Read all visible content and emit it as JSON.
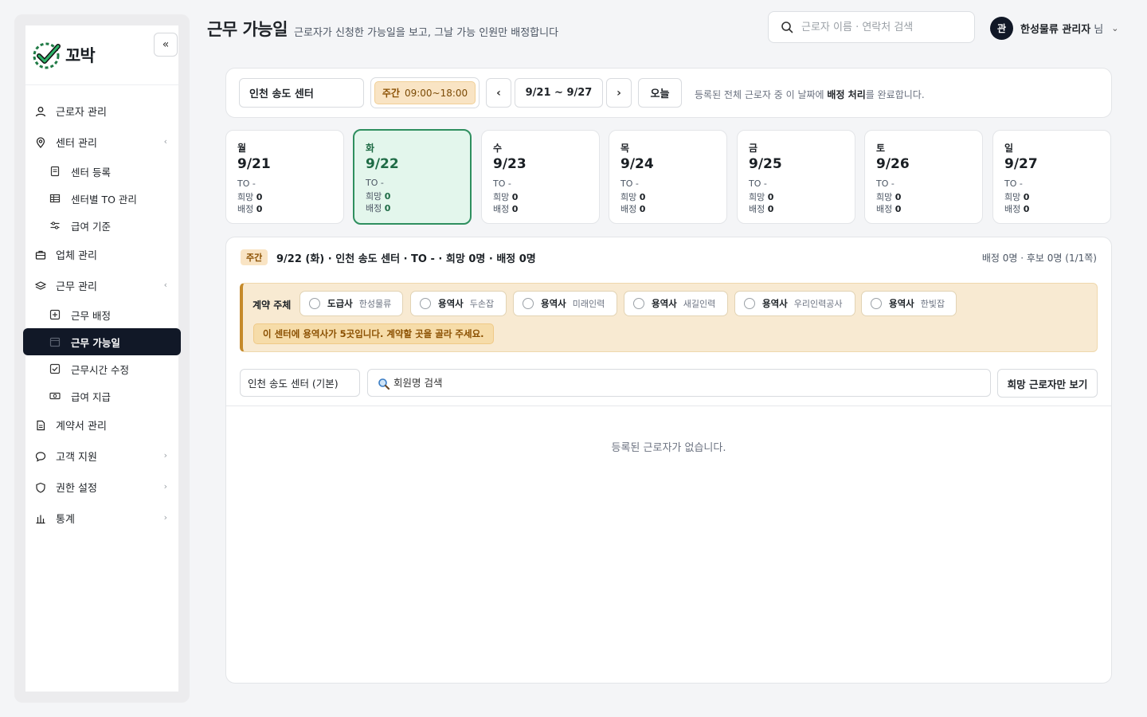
{
  "app": {
    "logo_text": "꼬박"
  },
  "sidebar": {
    "collapse_label": "«",
    "items": [
      {
        "label": "근로자 관리",
        "icon": "user-icon",
        "type": "item"
      },
      {
        "label": "센터 관리",
        "icon": "location-pin-icon",
        "type": "item",
        "chevron": "‹"
      },
      {
        "label": "센터 등록",
        "icon": "document-icon",
        "type": "sub"
      },
      {
        "label": "센터별 TO 관리",
        "icon": "table-icon",
        "type": "sub"
      },
      {
        "label": "급여 기준",
        "icon": "sliders-icon",
        "type": "sub"
      },
      {
        "label": "업체 관리",
        "icon": "briefcase-icon",
        "type": "item"
      },
      {
        "label": "근무 관리",
        "icon": "layers-icon",
        "type": "item",
        "chevron": "‹"
      },
      {
        "label": "근무 배정",
        "icon": "plus-square-icon",
        "type": "sub"
      },
      {
        "label": "근무 가능일",
        "icon": "calendar-icon",
        "type": "sub",
        "active": true
      },
      {
        "label": "근무시간 수정",
        "icon": "check-square-icon",
        "type": "sub"
      },
      {
        "label": "급여 지급",
        "icon": "banknote-icon",
        "type": "sub"
      },
      {
        "label": "계약서 관리",
        "icon": "contract-icon",
        "type": "item"
      },
      {
        "label": "고객 지원",
        "icon": "chat-icon",
        "type": "item",
        "chevron": "›"
      },
      {
        "label": "권한 설정",
        "icon": "shield-icon",
        "type": "item",
        "chevron": "›"
      },
      {
        "label": "통계",
        "icon": "bar-chart-icon",
        "type": "item",
        "chevron": "›"
      }
    ]
  },
  "header": {
    "title": "근무 가능일",
    "subtitle": "근로자가 신청한 가능일을 보고, 그날 가능 인원만 배정합니다",
    "search_placeholder": "근로자 이름 · 연락처 검색",
    "user_avatar": "관",
    "user_name": "한성물류 관리자",
    "user_suffix": "님",
    "user_chevron": "⌄"
  },
  "toolbar": {
    "center": "인천 송도 센터",
    "shift_label": "주간",
    "shift_time": "09:00~18:00",
    "prev": "‹",
    "range": "9/21 ~ 9/27",
    "next": "›",
    "today": "오늘",
    "note_prefix": "등록된 전체 근로자 중 이 날짜에 ",
    "note_bold": "배정 처리",
    "note_suffix": "를 완료합니다."
  },
  "days": [
    {
      "dow": "월",
      "date": "9/21",
      "to": "TO -",
      "hope_label": "희망",
      "hope": "0",
      "assign_label": "배정",
      "assign": "0"
    },
    {
      "dow": "화",
      "date": "9/22",
      "to": "TO -",
      "hope_label": "희망",
      "hope": "0",
      "assign_label": "배정",
      "assign": "0",
      "selected": true
    },
    {
      "dow": "수",
      "date": "9/23",
      "to": "TO -",
      "hope_label": "희망",
      "hope": "0",
      "assign_label": "배정",
      "assign": "0"
    },
    {
      "dow": "목",
      "date": "9/24",
      "to": "TO -",
      "hope_label": "희망",
      "hope": "0",
      "assign_label": "배정",
      "assign": "0"
    },
    {
      "dow": "금",
      "date": "9/25",
      "to": "TO -",
      "hope_label": "희망",
      "hope": "0",
      "assign_label": "배정",
      "assign": "0"
    },
    {
      "dow": "토",
      "date": "9/26",
      "to": "TO -",
      "hope_label": "희망",
      "hope": "0",
      "assign_label": "배정",
      "assign": "0"
    },
    {
      "dow": "일",
      "date": "9/27",
      "to": "TO -",
      "hope_label": "희망",
      "hope": "0",
      "assign_label": "배정",
      "assign": "0"
    }
  ],
  "panel": {
    "tag": "주간",
    "title": "9/22 (화) · 인천 송도 센터 · TO - · 희망 0명 · 배정 0명",
    "summary": "배정 0명 · 후보 0명 (1/1쪽)",
    "contract_label": "계약 주체",
    "options": [
      {
        "role": "도급사",
        "name": "한성물류"
      },
      {
        "role": "용역사",
        "name": "두손잡"
      },
      {
        "role": "용역사",
        "name": "미래인력"
      },
      {
        "role": "용역사",
        "name": "새길인력"
      },
      {
        "role": "용역사",
        "name": "우리인력공사"
      },
      {
        "role": "용역사",
        "name": "한빛잡"
      }
    ],
    "warning": "이 센터에 용역사가 5곳입니다. 계약할 곳을 골라 주세요.",
    "filter_center": "인천 송도 센터 (기본)",
    "member_search_placeholder": "회원명 검색",
    "only_hope_button": "희망 근로자만 보기",
    "empty": "등록된 근로자가 없습니다."
  },
  "colors": {
    "active_nav": "#111827",
    "selected_day_bg": "#e3f6ec",
    "selected_day_border": "#2f8f5f",
    "shift_badge": "#f9e4c4",
    "contract_bg": "#f8ead2"
  }
}
